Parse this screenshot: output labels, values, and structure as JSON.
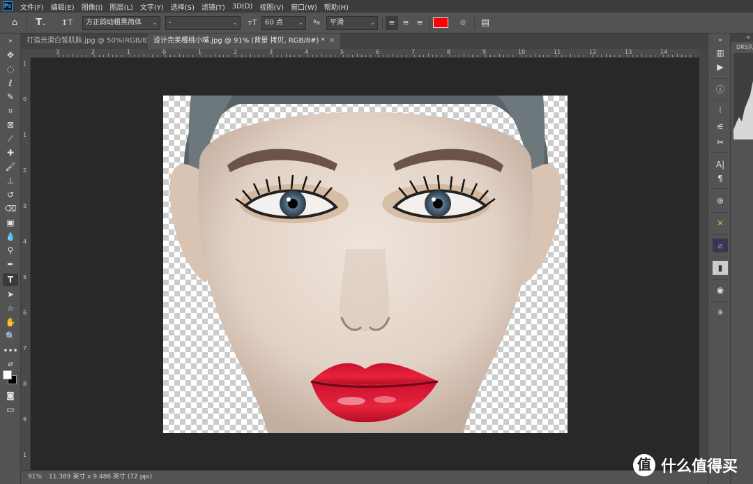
{
  "app": {
    "logo_text": "Ps"
  },
  "menu": [
    "文件(F)",
    "编辑(E)",
    "图像(I)",
    "图层(L)",
    "文字(Y)",
    "选择(S)",
    "滤镜(T)",
    "3D(D)",
    "视图(V)",
    "窗口(W)",
    "帮助(H)"
  ],
  "options_bar": {
    "font_family": "方正韵动粗黑简体",
    "font_style": "-",
    "font_size": "60 点",
    "aa_label": "ªa",
    "antialias": "平滑",
    "text_color": "#ff0000"
  },
  "tabs": [
    {
      "label": "打造光滑白皙肌肤.jpg @ 50%(RGB/8)",
      "active": false
    },
    {
      "label": "设计完美樱桃小嘴.jpg @ 91% (背景 拷贝, RGB/8#) *",
      "active": true
    }
  ],
  "ruler_top_labels": [
    "3",
    "2",
    "1",
    "0",
    "1",
    "2",
    "3",
    "4",
    "5",
    "6",
    "7",
    "8",
    "9",
    "10",
    "11",
    "12",
    "13",
    "14"
  ],
  "ruler_left_labels": [
    "1",
    "0",
    "1",
    "2",
    "3",
    "4",
    "5",
    "6",
    "7",
    "8",
    "9",
    "1",
    "0"
  ],
  "status": {
    "zoom": "91%",
    "doc_size": "11.389 英寸 x 9.486 英寸 (72 ppi)"
  },
  "right_panel": {
    "title": "DRS久"
  },
  "watermark": {
    "logo": "值",
    "text": "什么值得买"
  }
}
